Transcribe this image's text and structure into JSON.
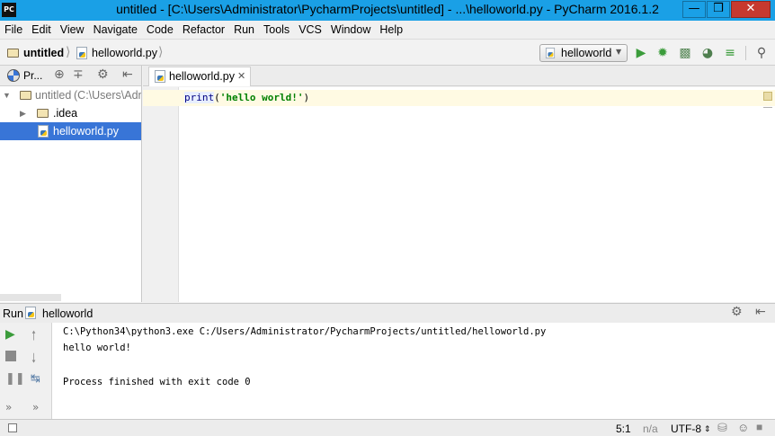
{
  "window": {
    "title": "untitled - [C:\\Users\\Administrator\\PycharmProjects\\untitled] - ...\\helloworld.py - PyCharm 2016.1.2",
    "app_icon_text": "PC",
    "minimize": "—",
    "maximize": "❒",
    "close": "✕"
  },
  "menu": [
    "File",
    "Edit",
    "View",
    "Navigate",
    "Code",
    "Refactor",
    "Run",
    "Tools",
    "VCS",
    "Window",
    "Help"
  ],
  "navbar": {
    "crumb_project": "untitled",
    "crumb_file": "helloworld.py",
    "run_config": "helloworld"
  },
  "project_panel": {
    "view_label": "Pr...",
    "tree": [
      {
        "label": "untitled",
        "path": "(C:\\Users\\Admi"
      },
      {
        "label": ".idea"
      },
      {
        "label": "helloworld.py"
      }
    ]
  },
  "editor": {
    "tab_label": "helloworld.py",
    "code": {
      "func": "print",
      "open": "(",
      "string": "'hello world!'",
      "close": ")"
    }
  },
  "run_panel": {
    "label": "Run",
    "config": "helloworld",
    "lines": [
      "C:\\Python34\\python3.exe C:/Users/Administrator/PycharmProjects/untitled/helloworld.py",
      "hello world!",
      "",
      "Process finished with exit code 0"
    ]
  },
  "status": {
    "position": "5:1",
    "line_sep": "n/a",
    "encoding": "UTF-8"
  },
  "colors": {
    "titlebar": "#1aa0e6",
    "selection": "#3875d7",
    "run_green": "#3b9c3b",
    "keyword_blue": "#000080",
    "string_green": "#008000"
  }
}
